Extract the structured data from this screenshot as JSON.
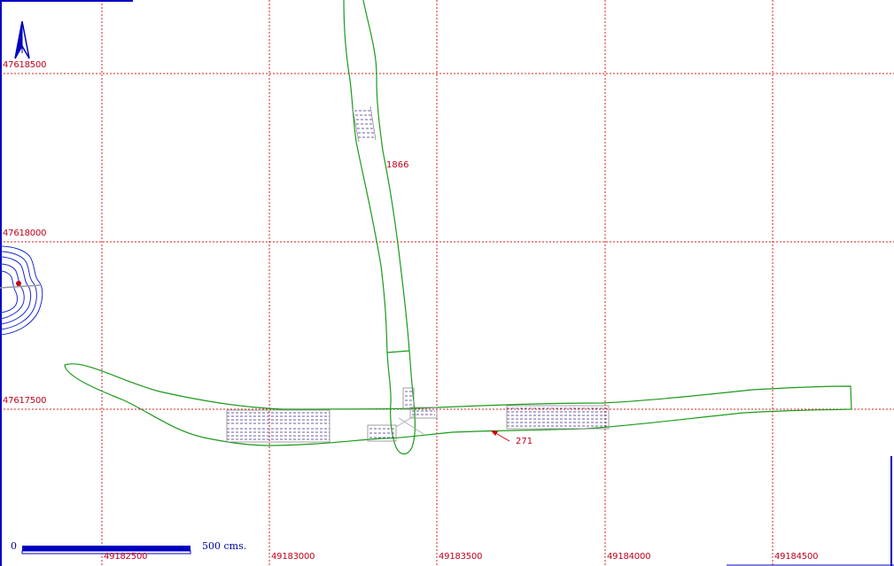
{
  "map": {
    "easting_labels": [
      "49182500",
      "49183000",
      "49183500",
      "49184000",
      "49184500"
    ],
    "northing_labels": [
      "47618500",
      "47618000",
      "47617500"
    ],
    "feature_labels": {
      "vertical_path": "1866",
      "horizontal_path": "271"
    },
    "scale_bar": {
      "start_label": "0",
      "end_label": "500 cms."
    },
    "north_arrow": {
      "icon": "north-arrow-icon"
    },
    "colors": {
      "grid": "#d8201c",
      "path_outline": "#1a9a1a",
      "hatch": "#3b2a8a",
      "labels": "#c0001a",
      "frame": "#0000c0",
      "arrow_pointer": "#d00000"
    }
  }
}
